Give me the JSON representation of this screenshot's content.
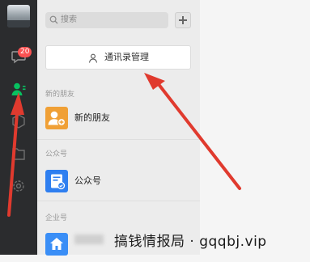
{
  "sidebar": {
    "unread_badge": "20",
    "icons": [
      "avatar",
      "chat-icon",
      "contacts-icon",
      "favorites-icon",
      "files-icon",
      "settings-icon"
    ]
  },
  "search": {
    "placeholder": "搜索"
  },
  "contacts_manage_button": "通讯录管理",
  "sections": [
    {
      "label": "新的朋友",
      "item": "新的朋友",
      "icon": "new-friend-icon"
    },
    {
      "label": "公众号",
      "item": "公众号",
      "icon": "official-account-icon"
    },
    {
      "label": "企业号",
      "icon": "enterprise-home-icon"
    }
  ],
  "watermark": "搞钱情报局 · gqqbj.vip",
  "colors": {
    "sidebar_bg": "#2b2c2e",
    "active_icon": "#07c160",
    "badge": "#fa5151",
    "new_friend_icon_bg": "#f0a036",
    "official_account_icon_bg": "#2f7ff0",
    "enterprise_icon_bg": "#3a8ef6",
    "arrow": "#e03a2e"
  }
}
